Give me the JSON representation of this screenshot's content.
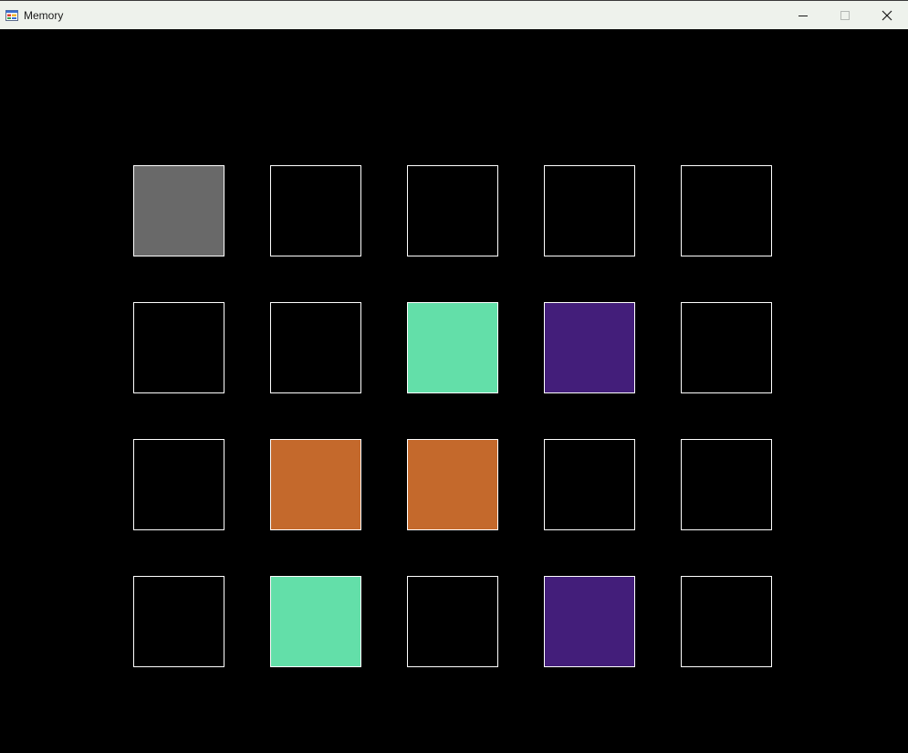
{
  "window": {
    "title": "Memory",
    "icon": "app-icon",
    "controls": [
      "minimize-icon",
      "maximize-icon",
      "close-icon"
    ]
  },
  "board": {
    "rows": 4,
    "cols": 5,
    "colors": {
      "hidden": "#000000",
      "selected": "#696969",
      "mint": "#63dfa9",
      "purple": "#431e7a",
      "orange": "#c4692c",
      "border": "#ffffff"
    },
    "tiles": [
      [
        "selected",
        "hidden",
        "hidden",
        "hidden",
        "hidden"
      ],
      [
        "hidden",
        "hidden",
        "mint",
        "purple",
        "hidden"
      ],
      [
        "hidden",
        "orange",
        "orange",
        "hidden",
        "hidden"
      ],
      [
        "hidden",
        "mint",
        "hidden",
        "purple",
        "hidden"
      ]
    ]
  }
}
